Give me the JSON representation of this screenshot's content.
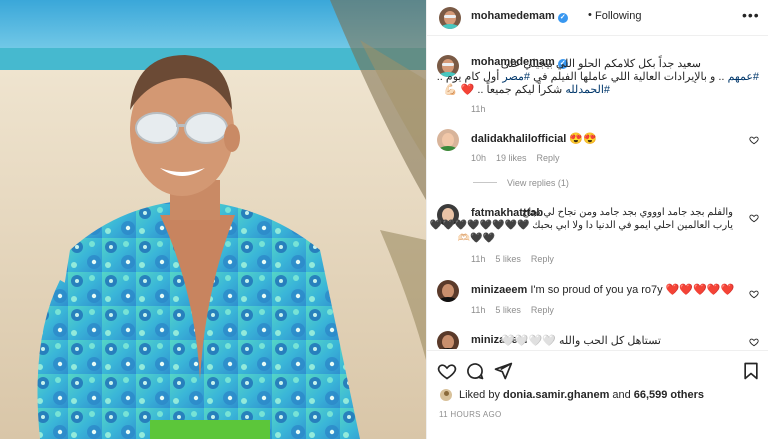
{
  "colors": {
    "accent_blue": "#3897f0",
    "hashtag": "#00376b",
    "text": "#262626",
    "muted": "#8e8e8e",
    "red_heart": "#ed1c24"
  },
  "post": {
    "username": "mohamedemam",
    "separator": "•",
    "follow_status": "Following",
    "more_icon": "more-horizontal-icon"
  },
  "caption": {
    "username": "mohamedemam",
    "line1": "سعيد جداً بكل كلامكم الحلو اللي بيجيلي على",
    "line2_hashtag": "#عمهم",
    "line2_mid": " .. و بالإيرادات العالية اللي عاملها الفيلم في ",
    "line2_hashtag2": "#مصر",
    "line2_end": " أول كام يوم ..",
    "line3_text": "شكراً ليكم جميعاً .. ",
    "line3_hashtag": "#الحمدلله",
    "line3_emoji": "❤️ 💪🏻",
    "time": "11h"
  },
  "comments": [
    {
      "username": "dalidakhalilofficial",
      "text": "😍😍",
      "time": "10h",
      "likes": "19 likes",
      "reply": "Reply",
      "view_replies": "View replies (1)"
    },
    {
      "username": "fatmakhatttab",
      "text_line1": "والفلم بجد جامد اوووي بجد جامد ومن نجاح لي نجاح",
      "text_line2": "يارب العالمين احلي ايمو في الدنيا دا ولا ابي بحبك 🖤🖤🖤🖤🖤🖤🖤🖤",
      "text_line3": "🖤🖤🫶🏻",
      "time": "11h",
      "likes": "5 likes",
      "reply": "Reply"
    },
    {
      "username": "minizaeem",
      "text": "I'm so proud of you ya ro7y",
      "hearts": "❤️❤️❤️❤️❤️",
      "time": "11h",
      "likes": "5 likes",
      "reply": "Reply"
    },
    {
      "username": "minizaeem",
      "text": "تستاهل كل الحب والله 🤍🤍🤍🤍"
    }
  ],
  "actions": {
    "like_icon": "heart-icon",
    "comment_icon": "comment-icon",
    "share_icon": "share-icon",
    "save_icon": "bookmark-icon"
  },
  "likes": {
    "prefix": "Liked by ",
    "user": "donia.samir.ghanem",
    "mid": " and ",
    "others": "66,599 others"
  },
  "posted": "11 HOURS AGO"
}
